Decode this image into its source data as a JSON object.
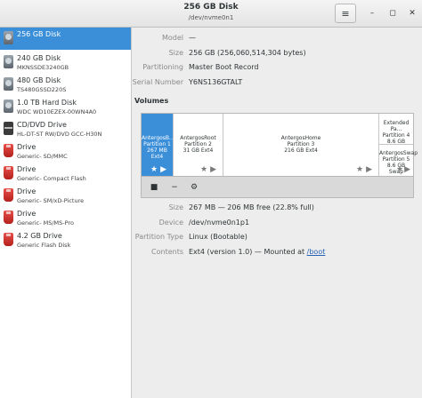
{
  "header": {
    "title": "256 GB Disk",
    "subtitle": "/dev/nvme0n1",
    "menu_icon": "≡",
    "min_icon": "–",
    "max_icon": "◻",
    "close_icon": "✕"
  },
  "sidebar": {
    "items": [
      {
        "name": "256 GB Disk",
        "model": "",
        "icon": "hdd"
      },
      {
        "name": "240 GB Disk",
        "model": "MKNSSDE3240GB",
        "icon": "hdd"
      },
      {
        "name": "480 GB Disk",
        "model": "TS480GSSD220S",
        "icon": "hdd"
      },
      {
        "name": "1.0 TB Hard Disk",
        "model": "WDC WD10EZEX-00WN4A0",
        "icon": "hdd"
      },
      {
        "name": "CD/DVD Drive",
        "model": "HL-DT-ST RW/DVD GCC-H30N",
        "icon": "optical"
      },
      {
        "name": "Drive",
        "model": "Generic- SD/MMC",
        "icon": "flash"
      },
      {
        "name": "Drive",
        "model": "Generic- Compact Flash",
        "icon": "flash"
      },
      {
        "name": "Drive",
        "model": "Generic- SM/xD-Picture",
        "icon": "flash"
      },
      {
        "name": "Drive",
        "model": "Generic- MS/MS-Pro",
        "icon": "flash"
      },
      {
        "name": "4.2 GB Drive",
        "model": "Generic Flash Disk",
        "icon": "flash"
      }
    ]
  },
  "disk_props": {
    "model_label": "Model",
    "model_value": "—",
    "size_label": "Size",
    "size_value": "256 GB (256,060,514,304 bytes)",
    "partitioning_label": "Partitioning",
    "partitioning_value": "Master Boot Record",
    "serial_label": "Serial Number",
    "serial_value": "Y6NS136GTALT"
  },
  "volumes": {
    "title": "Volumes",
    "partitions": [
      {
        "line1": "AntergosB...",
        "line2": "Partition 1",
        "line3": "267 MB Ext4"
      },
      {
        "line1": "AntergosRoot",
        "line2": "Partition 2",
        "line3": "31 GB Ext4"
      },
      {
        "line1": "AntergosHome",
        "line2": "Partition 3",
        "line3": "216 GB Ext4"
      }
    ],
    "extended": {
      "line1": "Extended Pa...",
      "line2": "Partition 4",
      "line3": "8.6 GB"
    },
    "swap": {
      "line1": "AntergosSwap",
      "line2": "Partition 5",
      "line3": "8.6 GB Swap"
    },
    "icons": {
      "star": "★",
      "play": "▶",
      "stop": "■",
      "minus": "−",
      "gears": "⚙"
    }
  },
  "partition_props": {
    "size_label": "Size",
    "size_value": "267 MB — 206 MB free (22.8% full)",
    "device_label": "Device",
    "device_value": "/dev/nvme0n1p1",
    "type_label": "Partition Type",
    "type_value": "Linux (Bootable)",
    "contents_label": "Contents",
    "contents_value": "Ext4 (version 1.0) — Mounted at",
    "mount_link": "/boot"
  }
}
